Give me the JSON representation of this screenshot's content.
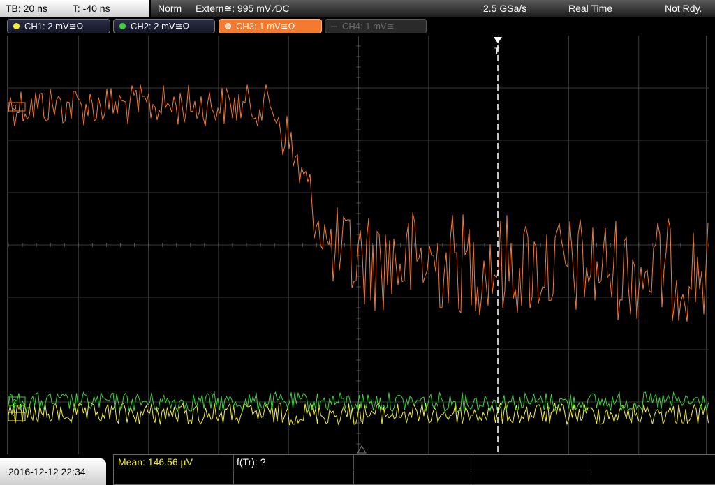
{
  "top_bar": {
    "timebase": "TB: 20 ns",
    "trigger_time": "T: -40 ns",
    "mode": "Norm",
    "trigger_source": "Extern≅: 995 mV ⁄DC",
    "sample_rate": "2.5 GSa/s",
    "acquisition": "Real Time",
    "status": "Not Rdy."
  },
  "channels": [
    {
      "label": "CH1: 2 mV≅Ω",
      "color": "#f3ee3a",
      "state": "on"
    },
    {
      "label": "CH2: 2 mV≅Ω",
      "color": "#38d43a",
      "state": "on"
    },
    {
      "label": "CH3: 1 mV≅Ω",
      "color": "#f47a30",
      "state": "selected"
    },
    {
      "label": "CH4: 1 mV≅",
      "color": "#555555",
      "state": "off"
    }
  ],
  "markers": {
    "trigger": "T",
    "ch3": "3",
    "ch2": "2",
    "ch1": "1"
  },
  "colors": {
    "ch1": "#f3ee3a",
    "ch2": "#38d43a",
    "ch3": "#f47a30",
    "grid": "#3a3a3a"
  },
  "bottom_bar": {
    "datetime": "2016-12-12 22:34",
    "mean": "Mean: 146.56 µV",
    "ftr": "f(Tr): ?"
  }
}
